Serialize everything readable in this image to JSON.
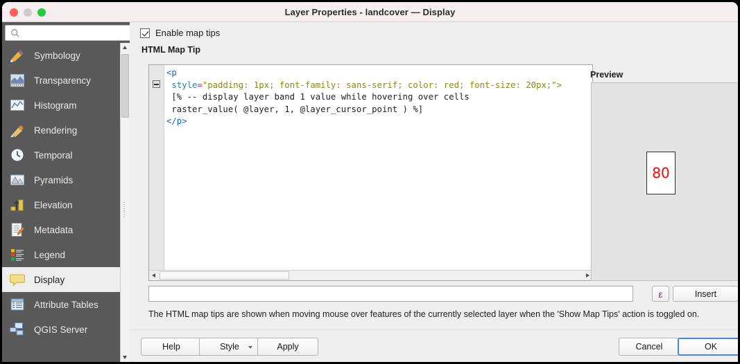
{
  "window": {
    "title": "Layer Properties - landcover — Display",
    "traffic_lights": [
      "close-button",
      "minimize-button",
      "maximize-button"
    ]
  },
  "sidebar": {
    "search": {
      "value": "",
      "placeholder": "",
      "icon": "search-icon"
    },
    "items": [
      {
        "label": "Symbology",
        "icon": "symbology-icon",
        "active": false
      },
      {
        "label": "Transparency",
        "icon": "transparency-icon",
        "active": false
      },
      {
        "label": "Histogram",
        "icon": "histogram-icon",
        "active": false
      },
      {
        "label": "Rendering",
        "icon": "rendering-icon",
        "active": false
      },
      {
        "label": "Temporal",
        "icon": "temporal-clock-icon",
        "active": false
      },
      {
        "label": "Pyramids",
        "icon": "pyramids-icon",
        "active": false
      },
      {
        "label": "Elevation",
        "icon": "elevation-icon",
        "active": false
      },
      {
        "label": "Metadata",
        "icon": "metadata-icon",
        "active": false
      },
      {
        "label": "Legend",
        "icon": "legend-icon",
        "active": false
      },
      {
        "label": "Display",
        "icon": "display-speech-icon",
        "active": true
      },
      {
        "label": "Attribute Tables",
        "icon": "attribute-tables-icon",
        "active": false
      },
      {
        "label": "QGIS Server",
        "icon": "qgis-server-icon",
        "active": false
      }
    ]
  },
  "main": {
    "enable_map_tips": {
      "label": "Enable map tips",
      "checked": true
    },
    "group_title": "HTML Map Tip",
    "editor": {
      "lines": [
        [
          {
            "t": "<p",
            "c": "tag"
          }
        ],
        [
          {
            "t": " ",
            "c": "plain"
          },
          {
            "t": "style",
            "c": "attr"
          },
          {
            "t": "=",
            "c": "eq"
          },
          {
            "t": "\"padding: 1px; font-family: sans-serif; color: red; font-size: 20px;\">",
            "c": "str"
          }
        ],
        [
          {
            "t": " [% -- display layer band 1 value while hovering over cells",
            "c": "plain"
          }
        ],
        [
          {
            "t": " raster_value( @layer, 1, @layer_cursor_point ) %]",
            "c": "plain"
          }
        ],
        [
          {
            "t": "</p>",
            "c": "tag"
          }
        ]
      ],
      "plain_text": "<p\n style=\"padding: 1px; font-family: sans-serif; color: red; font-size: 20px;\">\n [% -- display layer band 1 value while hovering over cells\n raster_value( @layer, 1, @layer_cursor_point ) %]\n</p>",
      "fold_marker": "collapse-fold-marker"
    },
    "preview": {
      "title": "Preview",
      "tip_value": "80",
      "tip_color": "#ff0000"
    },
    "insert_row": {
      "input_value": "",
      "input_placeholder": "",
      "expression_button_label": "ε",
      "insert_button_label": "Insert"
    },
    "description": "The HTML map tips are shown when moving mouse over features of the currently selected layer when the 'Show Map Tips' action is toggled on."
  },
  "footer": {
    "help_label": "Help",
    "style_label": "Style",
    "apply_label": "Apply",
    "cancel_label": "Cancel",
    "ok_label": "OK"
  },
  "colors": {
    "sidebar_bg": "#595959",
    "panel_bg": "#efefef",
    "titlebar_bg": "#f7efef",
    "accent_focus": "#3f8ae0",
    "preview_value": "#ff0000",
    "expression_glyph": "#7b2d8e"
  }
}
